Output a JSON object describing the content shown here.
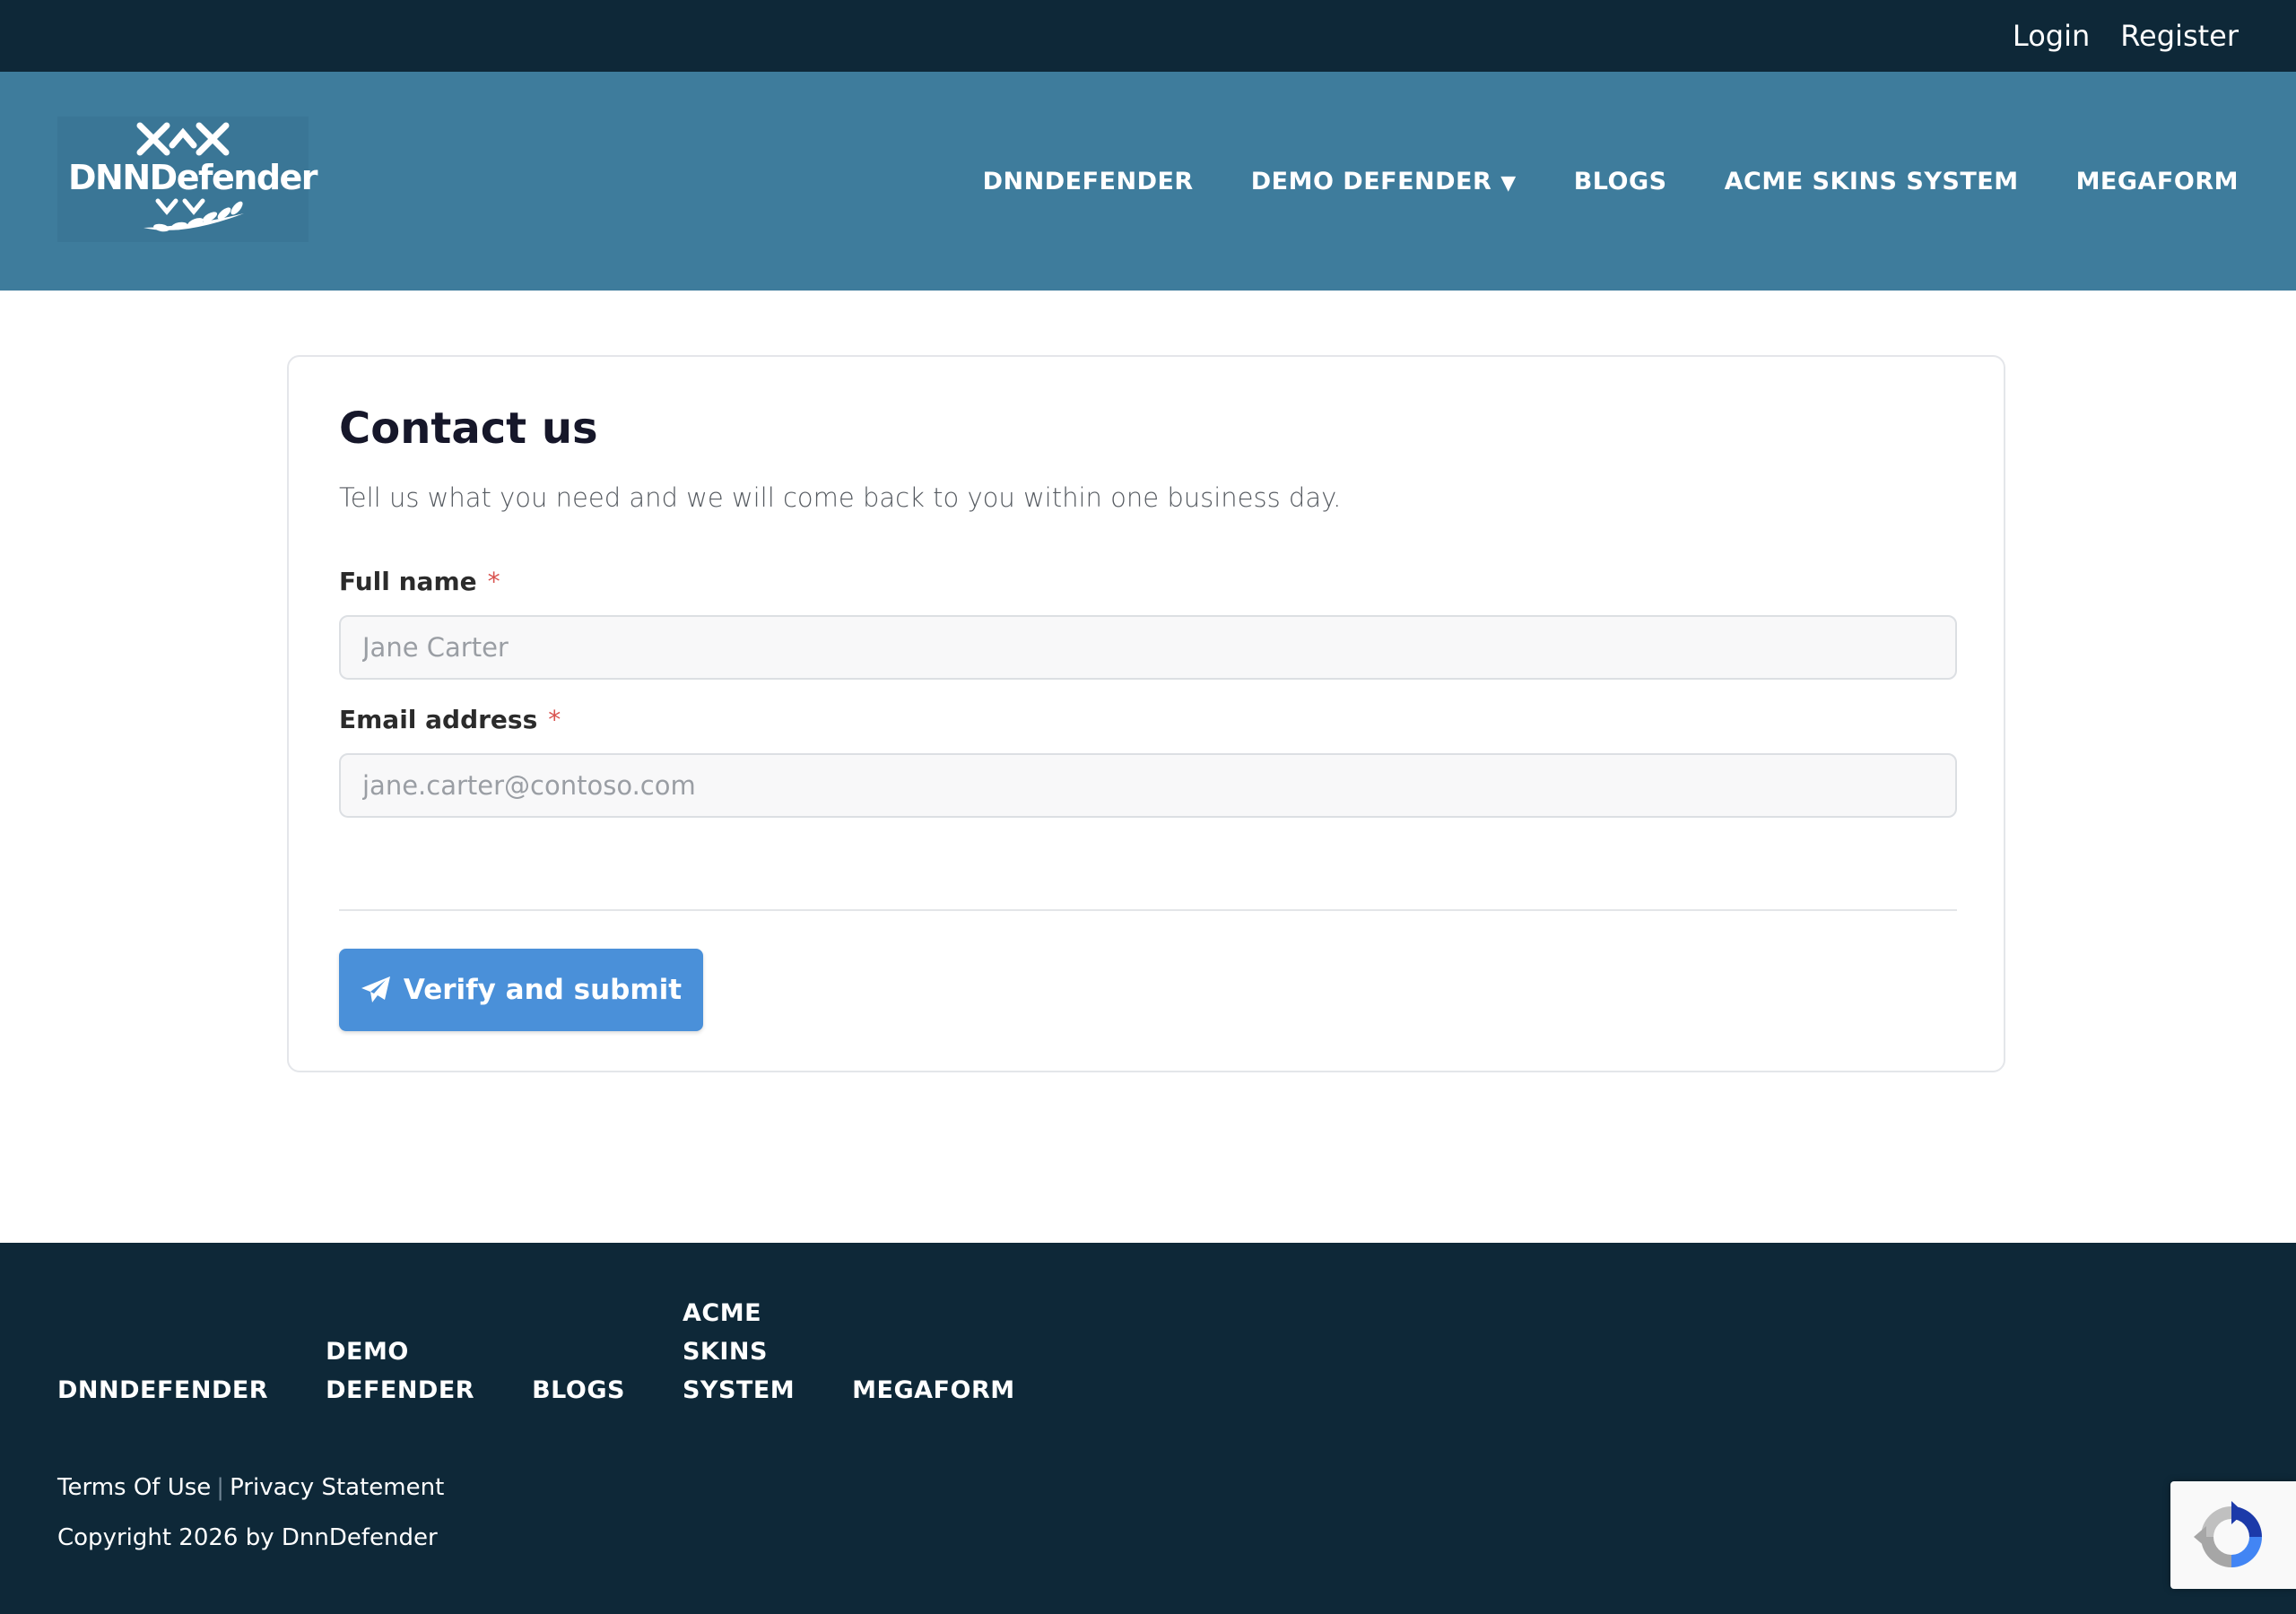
{
  "topbar": {
    "login_label": "Login",
    "register_label": "Register"
  },
  "header": {
    "logo_text": "DNNDefender",
    "nav": [
      {
        "label": "DNNDEFENDER"
      },
      {
        "label": "DEMO DEFENDER",
        "caret": "▼"
      },
      {
        "label": "BLOGS"
      },
      {
        "label": "ACME SKINS SYSTEM"
      },
      {
        "label": "MEGAFORM"
      }
    ]
  },
  "form": {
    "title": "Contact us",
    "subtitle": "Tell us what you need and we will come back to you within one business day.",
    "required_marker": "*",
    "full_name": {
      "label": "Full name",
      "placeholder": "Jane Carter",
      "value": ""
    },
    "email": {
      "label": "Email address",
      "placeholder": "jane.carter@contoso.com",
      "value": ""
    },
    "submit_label": "Verify and submit",
    "submit_icon": "paper-plane-icon"
  },
  "footer": {
    "nav": [
      {
        "line1": "DNNDEFENDER"
      },
      {
        "line1": "DEMO",
        "line2": "DEFENDER"
      },
      {
        "line1": "BLOGS"
      },
      {
        "line1": "ACME",
        "line2": "SKINS",
        "line3": "SYSTEM"
      },
      {
        "line1": "MEGAFORM"
      }
    ],
    "terms_label": "Terms Of Use",
    "separator": "|",
    "privacy_label": "Privacy Statement",
    "copyright": "Copyright 2026 by DnnDefender"
  },
  "colors": {
    "topbar_bg": "#0e2838",
    "header_bg": "#3e7c9c",
    "button_bg": "#4a90d9",
    "required": "#d9534f"
  }
}
